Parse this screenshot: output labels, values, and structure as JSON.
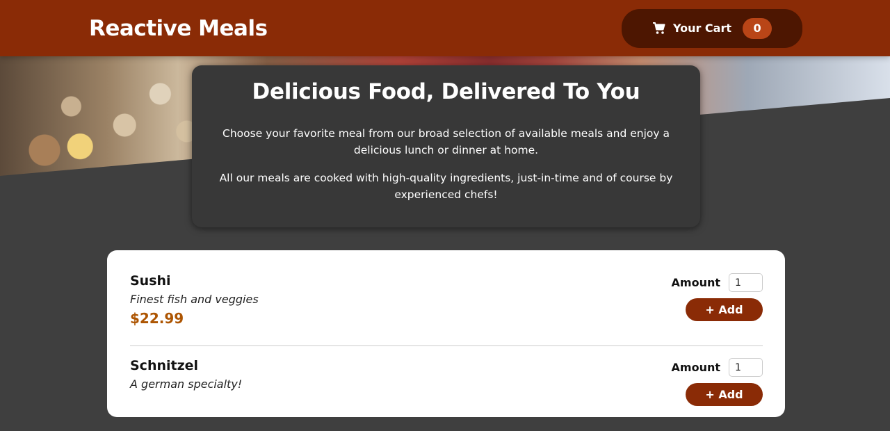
{
  "header": {
    "brand": "Reactive Meals",
    "cart": {
      "label": "Your Cart",
      "count": "0",
      "icon": "cart-icon"
    }
  },
  "summary": {
    "title": "Delicious Food, Delivered To You",
    "paragraph1": "Choose your favorite meal from our broad selection of available meals and enjoy a delicious lunch or dinner at home.",
    "paragraph2": "All our meals are cooked with high-quality ingredients, just-in-time and of course by experienced chefs!"
  },
  "meals": [
    {
      "name": "Sushi",
      "description": "Finest fish and veggies",
      "price": "$22.99",
      "amount_label": "Amount",
      "amount_value": "1",
      "add_label": "+ Add"
    },
    {
      "name": "Schnitzel",
      "description": "A german specialty!",
      "price": "",
      "amount_label": "Amount",
      "amount_value": "1",
      "add_label": "+ Add"
    }
  ],
  "colors": {
    "header_bg": "#8a2b06",
    "cart_bg": "#4d1601",
    "badge_bg": "#b94517",
    "price": "#ad5502",
    "page_bg": "#3f3f3f"
  }
}
